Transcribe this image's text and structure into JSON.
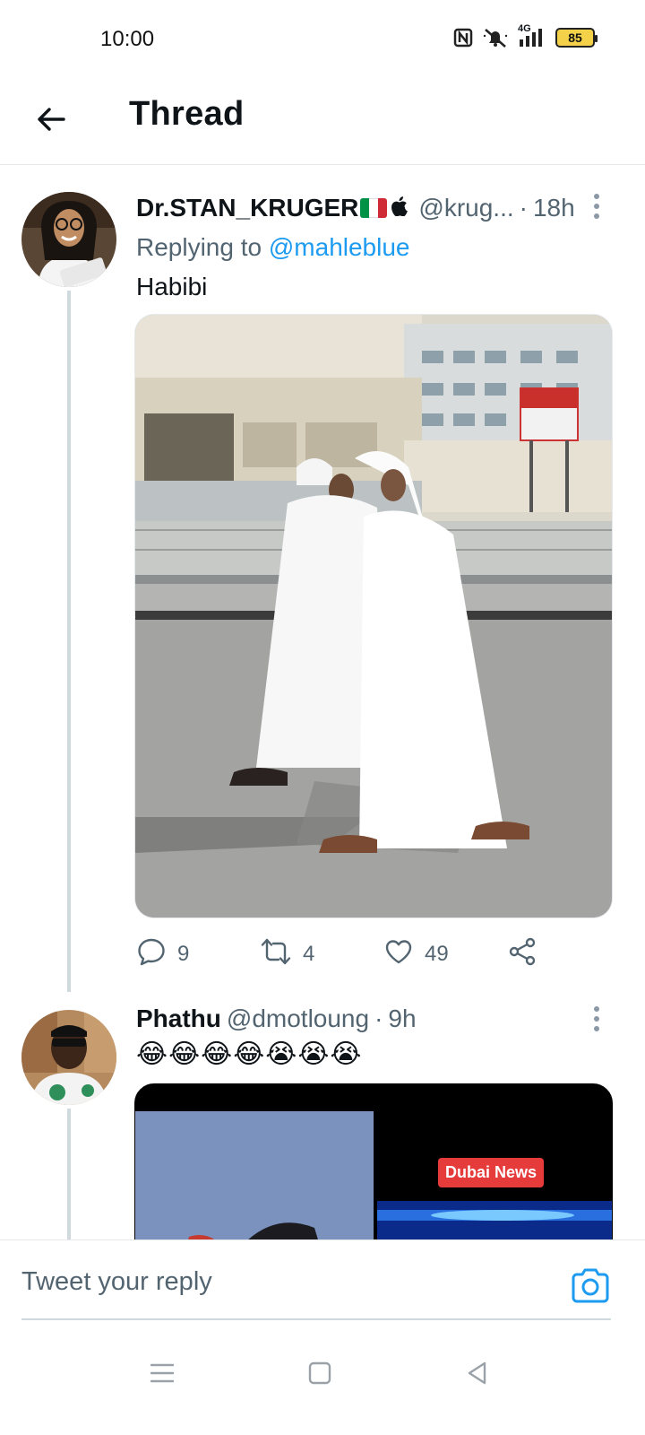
{
  "status_bar": {
    "time": "10:00",
    "network": "4G",
    "battery": "85",
    "icons": [
      "nfc-icon",
      "mute-icon",
      "signal-icon",
      "battery-icon"
    ]
  },
  "header": {
    "title": "Thread",
    "back_icon": "arrow-left-icon"
  },
  "tweets": [
    {
      "display_name": "Dr.STAN_KRUGER",
      "flag_colors": [
        "#009246",
        "#ffffff",
        "#ce2b37"
      ],
      "handle": "@krug...",
      "time": "18h",
      "replying_prefix": "Replying to",
      "replying_to": "@mahleblue",
      "text": "Habibi",
      "media": "photo",
      "stats": {
        "replies": "9",
        "retweets": "4",
        "likes": "49"
      }
    },
    {
      "display_name": "Phathu",
      "handle": "@dmotloung",
      "time": "9h",
      "emojis": [
        "😂",
        "😂",
        "😂",
        "😂",
        "😭",
        "😭",
        "😭"
      ],
      "media": "video",
      "media_label": "Dubai News"
    }
  ],
  "separator": "·",
  "reply_bar": {
    "placeholder": "Tweet your reply",
    "camera_icon": "camera-icon"
  },
  "nav_bar": {
    "icons": [
      "recents-menu-icon",
      "home-square-icon",
      "back-triangle-icon"
    ]
  },
  "colors": {
    "accent": "#1d9bf0",
    "secondary_text": "#536471",
    "thread_line": "#cfd9de"
  }
}
